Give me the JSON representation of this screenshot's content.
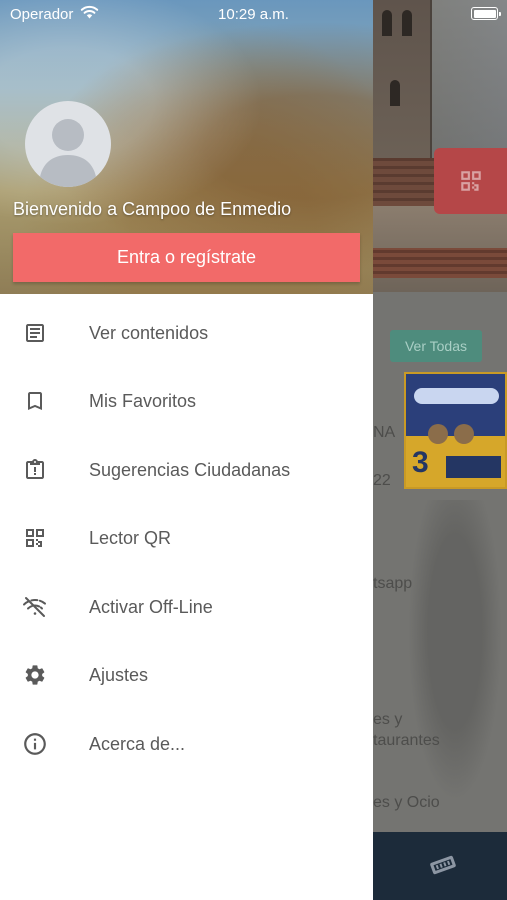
{
  "status_bar": {
    "carrier": "Operador",
    "time": "10:29 a.m."
  },
  "drawer": {
    "welcome_text": "Bienvenido a Campoo de Enmedio",
    "login_button": "Entra o regístrate",
    "menu": [
      {
        "label": "Ver contenidos",
        "icon": "article-icon"
      },
      {
        "label": "Mis Favoritos",
        "icon": "bookmark-icon"
      },
      {
        "label": "Sugerencias Ciudadanas",
        "icon": "clipboard-alert-icon"
      },
      {
        "label": "Lector QR",
        "icon": "qr-code-icon"
      },
      {
        "label": "Activar Off-Line",
        "icon": "wifi-off-icon"
      },
      {
        "label": "Ajustes",
        "icon": "gear-icon"
      },
      {
        "label": "Acerca de...",
        "icon": "info-icon"
      }
    ]
  },
  "background_app": {
    "see_all_button": "Ver Todas",
    "partial_texts": [
      "NA",
      "22",
      "tsapp",
      "es y",
      "taurantes",
      "es y Ocio"
    ]
  },
  "colors": {
    "accent": "#f26a69",
    "icon": "#5a5a5a",
    "tab_bar": "#1c2b3a"
  }
}
